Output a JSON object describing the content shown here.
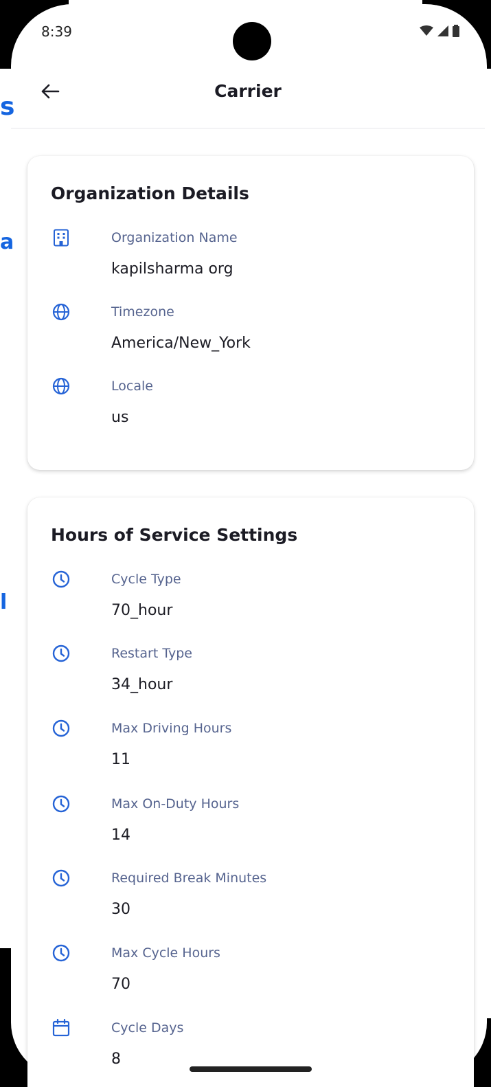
{
  "status_bar": {
    "time": "8:39",
    "icons": [
      "wifi-icon",
      "signal-icon",
      "battery-icon"
    ]
  },
  "edge_fragments": [
    "s",
    "a",
    "l"
  ],
  "app_bar": {
    "back_icon": "arrow-left-icon",
    "title": "Carrier"
  },
  "organization": {
    "title": "Organization Details",
    "fields": [
      {
        "icon": "building-icon",
        "label": "Organization Name",
        "value": "kapilsharma org"
      },
      {
        "icon": "globe-icon",
        "label": "Timezone",
        "value": "America/New_York"
      },
      {
        "icon": "globe-icon",
        "label": "Locale",
        "value": "us"
      }
    ]
  },
  "hours_of_service": {
    "title": "Hours of Service Settings",
    "fields": [
      {
        "icon": "clock-icon",
        "label": "Cycle Type",
        "value": "70_hour"
      },
      {
        "icon": "clock-icon",
        "label": "Restart Type",
        "value": "34_hour"
      },
      {
        "icon": "clock-icon",
        "label": "Max Driving Hours",
        "value": "11"
      },
      {
        "icon": "clock-icon",
        "label": "Max On-Duty Hours",
        "value": "14"
      },
      {
        "icon": "clock-icon",
        "label": "Required Break Minutes",
        "value": "30"
      },
      {
        "icon": "clock-icon",
        "label": "Max Cycle Hours",
        "value": "70"
      },
      {
        "icon": "calendar-icon",
        "label": "Cycle Days",
        "value": "8"
      }
    ]
  },
  "colors": {
    "accent": "#2563d6",
    "label": "#56648f",
    "text": "#1c1c24"
  }
}
